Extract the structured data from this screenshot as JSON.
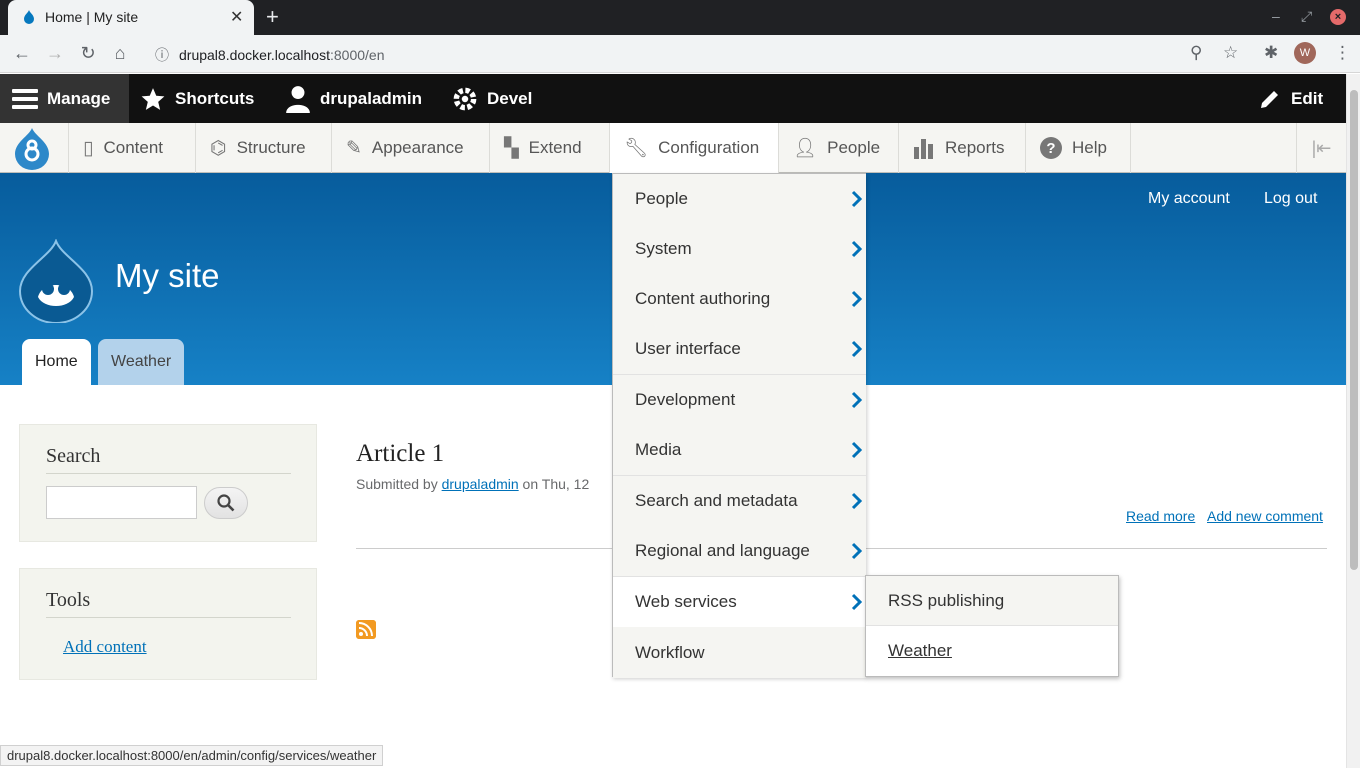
{
  "browser": {
    "tab_title": "Home | My site",
    "tab_close": "✕",
    "new_tab": "+",
    "url_host": "drupal8.docker.localhost",
    "url_path": ":8000/en",
    "avatar_letter": "W",
    "status_url": "drupal8.docker.localhost:8000/en/admin/config/services/weather"
  },
  "toolbar": {
    "manage": "Manage",
    "shortcuts": "Shortcuts",
    "user": "drupaladmin",
    "devel": "Devel",
    "edit": "Edit"
  },
  "tray": {
    "content": "Content",
    "structure": "Structure",
    "appearance": "Appearance",
    "extend": "Extend",
    "configuration": "Configuration",
    "people": "People",
    "reports": "Reports",
    "help": "Help"
  },
  "config_menu": [
    {
      "label": "People",
      "has_children": true
    },
    {
      "label": "System",
      "has_children": true
    },
    {
      "label": "Content authoring",
      "has_children": true
    },
    {
      "label": "User interface",
      "has_children": true
    },
    {
      "label": "Development",
      "has_children": true
    },
    {
      "label": "Media",
      "has_children": true
    },
    {
      "label": "Search and metadata",
      "has_children": true
    },
    {
      "label": "Regional and language",
      "has_children": true
    },
    {
      "label": "Web services",
      "has_children": true
    },
    {
      "label": "Workflow",
      "has_children": false
    }
  ],
  "submenu": {
    "rss": "RSS publishing",
    "weather": "Weather"
  },
  "site": {
    "name": "My site",
    "my_account": "My account",
    "log_out": "Log out",
    "tab_home": "Home",
    "tab_weather": "Weather"
  },
  "sidebar": {
    "search_title": "Search",
    "tools_title": "Tools",
    "add_content": "Add content"
  },
  "article": {
    "title": "Article 1",
    "submitted_prefix": "Submitted by ",
    "author": "drupaladmin",
    "submitted_suffix": " on Thu, 12",
    "read_more": "Read more",
    "add_comment": "Add new comment"
  },
  "colors": {
    "header_top": "#075c9c",
    "header_bottom": "#1681c6",
    "link": "#0071b8",
    "chevron": "#0071b8"
  }
}
